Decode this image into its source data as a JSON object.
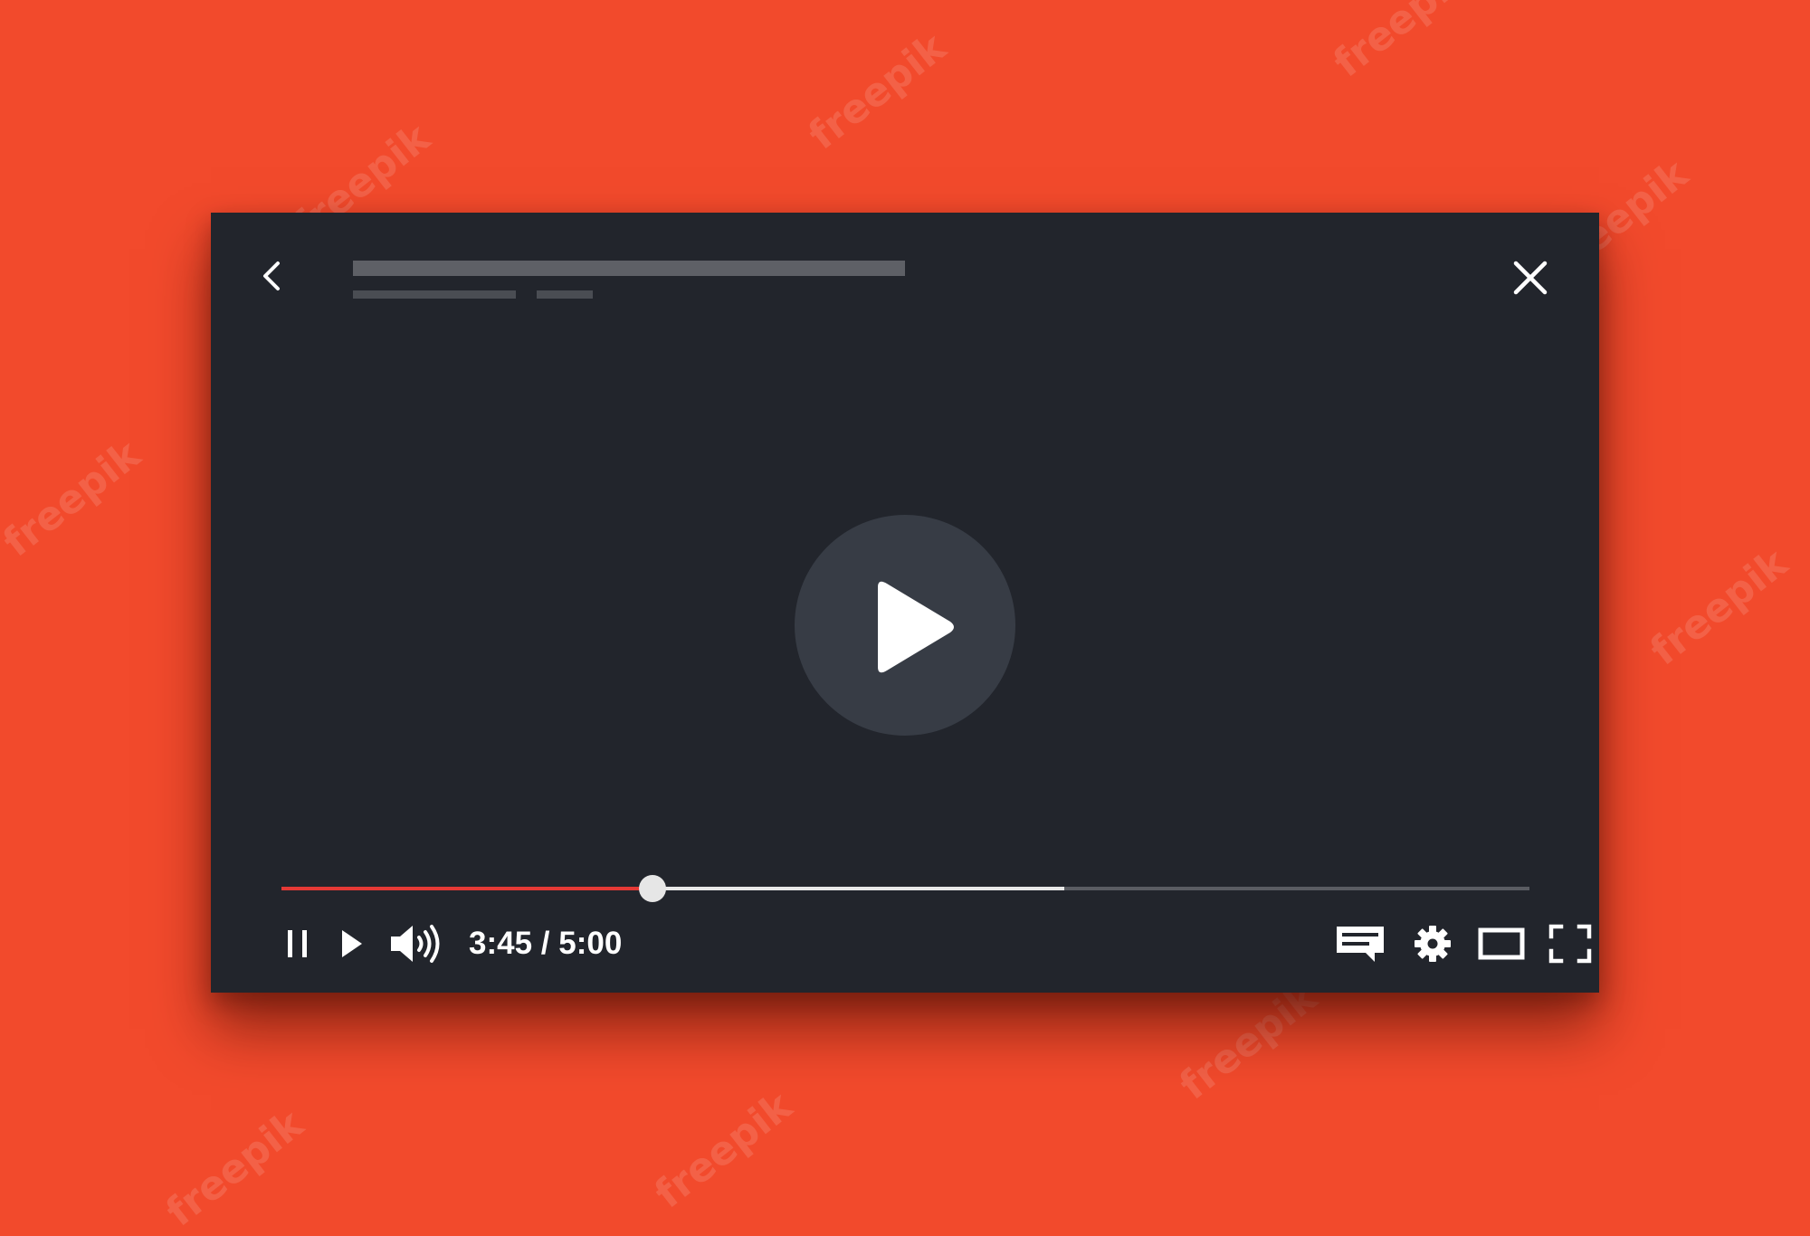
{
  "player": {
    "title": "",
    "time": {
      "current": "3:45",
      "separator": "/",
      "duration": "5:00"
    },
    "progress": {
      "played_fraction": 0.297,
      "buffered_fraction": 0.627
    },
    "colors": {
      "background": "#F24A2C",
      "player_bg": "#22252C",
      "played": "#E53935",
      "buffered": "#E8E8E8",
      "track": "#5A5C62",
      "center_button": "#373C45",
      "icon": "#FFFFFF"
    },
    "icons": {
      "back": "back-arrow-icon",
      "close": "close-icon",
      "center_play": "play-icon",
      "pause": "pause-icon",
      "play": "play-icon",
      "volume": "volume-icon",
      "captions": "captions-icon",
      "settings": "gear-icon",
      "theater": "theater-mode-icon",
      "fullscreen": "fullscreen-icon"
    }
  },
  "watermark": "freepik"
}
